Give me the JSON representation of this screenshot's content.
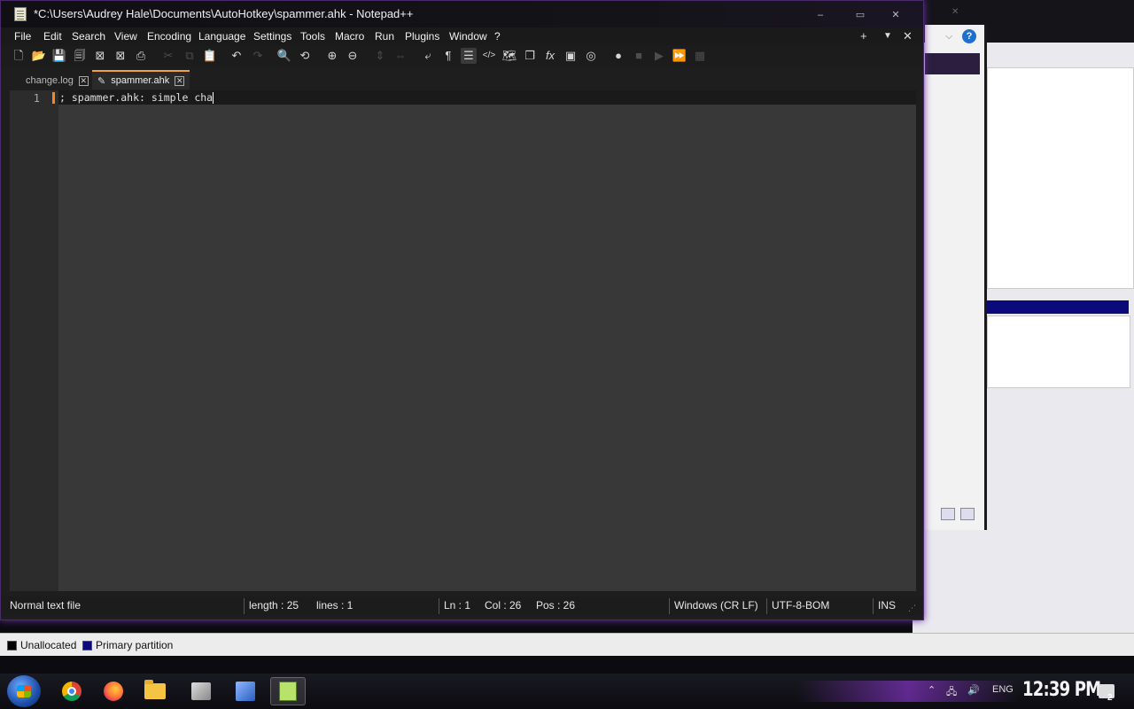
{
  "window": {
    "title": "*C:\\Users\\Audrey Hale\\Documents\\AutoHotkey\\spammer.ahk - Notepad++",
    "minimize": "–",
    "maximize": "▭",
    "close": "✕"
  },
  "menu": {
    "items": [
      "File",
      "Edit",
      "Search",
      "View",
      "Encoding",
      "Language",
      "Settings",
      "Tools",
      "Macro",
      "Run",
      "Plugins",
      "Window",
      "?"
    ],
    "right": {
      "add": "+",
      "dropdown": "▼",
      "close": "✕"
    }
  },
  "toolbar": {
    "icons": [
      {
        "name": "new-file-icon",
        "glyph": "🗋"
      },
      {
        "name": "open-file-icon",
        "glyph": "📂"
      },
      {
        "name": "save-icon",
        "glyph": "💾"
      },
      {
        "name": "save-all-icon",
        "glyph": "🗐"
      },
      {
        "name": "close-file-icon",
        "glyph": "⊠"
      },
      {
        "name": "close-all-icon",
        "glyph": "⊠"
      },
      {
        "name": "print-icon",
        "glyph": "⎙"
      },
      {
        "name": "cut-icon",
        "glyph": "✂"
      },
      {
        "name": "copy-icon",
        "glyph": "⧉"
      },
      {
        "name": "paste-icon",
        "glyph": "📋"
      },
      {
        "name": "undo-icon",
        "glyph": "↶"
      },
      {
        "name": "redo-icon",
        "glyph": "↷"
      },
      {
        "name": "find-icon",
        "glyph": "🔍"
      },
      {
        "name": "replace-icon",
        "glyph": "⟲"
      },
      {
        "name": "zoom-in-icon",
        "glyph": "⊕"
      },
      {
        "name": "zoom-out-icon",
        "glyph": "⊖"
      },
      {
        "name": "sync-vertical-icon",
        "glyph": "⇕"
      },
      {
        "name": "sync-horizontal-icon",
        "glyph": "⇔"
      },
      {
        "name": "word-wrap-icon",
        "glyph": "⤶"
      },
      {
        "name": "show-all-chars-icon",
        "glyph": "¶"
      },
      {
        "name": "indent-guide-icon",
        "glyph": "☰"
      },
      {
        "name": "xml-tag-icon",
        "glyph": "</>"
      },
      {
        "name": "document-map-icon",
        "glyph": "🗺"
      },
      {
        "name": "document-list-icon",
        "glyph": "❐"
      },
      {
        "name": "function-list-icon",
        "glyph": "fx"
      },
      {
        "name": "folder-workspace-icon",
        "glyph": "▣"
      },
      {
        "name": "monitoring-icon",
        "glyph": "◎"
      },
      {
        "name": "macro-record-icon",
        "glyph": "●"
      },
      {
        "name": "macro-stop-icon",
        "glyph": "■"
      },
      {
        "name": "macro-play-icon",
        "glyph": "▶"
      },
      {
        "name": "macro-play-multiple-icon",
        "glyph": "⏩"
      },
      {
        "name": "macro-save-icon",
        "glyph": "▦"
      }
    ]
  },
  "tabs": [
    {
      "label": "change.log",
      "close": "✕"
    },
    {
      "label": "spammer.ahk",
      "close": "✕",
      "modified_icon": "✎"
    }
  ],
  "editor": {
    "line_number": "1",
    "line_text": "; spammer.ahk: simple cha"
  },
  "status": {
    "file_type": "Normal text file",
    "length": "length : 25",
    "lines": "lines : 1",
    "ln": "Ln : 1",
    "col": "Col : 26",
    "pos": "Pos : 26",
    "eol": "Windows (CR LF)",
    "encoding": "UTF-8-BOM",
    "mode": "INS"
  },
  "legend": {
    "unallocated": "Unallocated",
    "primary": "Primary partition",
    "unallocated_color": "#000000",
    "primary_color": "#0a0a7a"
  },
  "taskbar": {
    "language": "ENG",
    "clock": "12:39 PM",
    "notifications": "2"
  },
  "colors": {
    "accent": "#f1a03a",
    "glow": "#8a3fd6"
  }
}
